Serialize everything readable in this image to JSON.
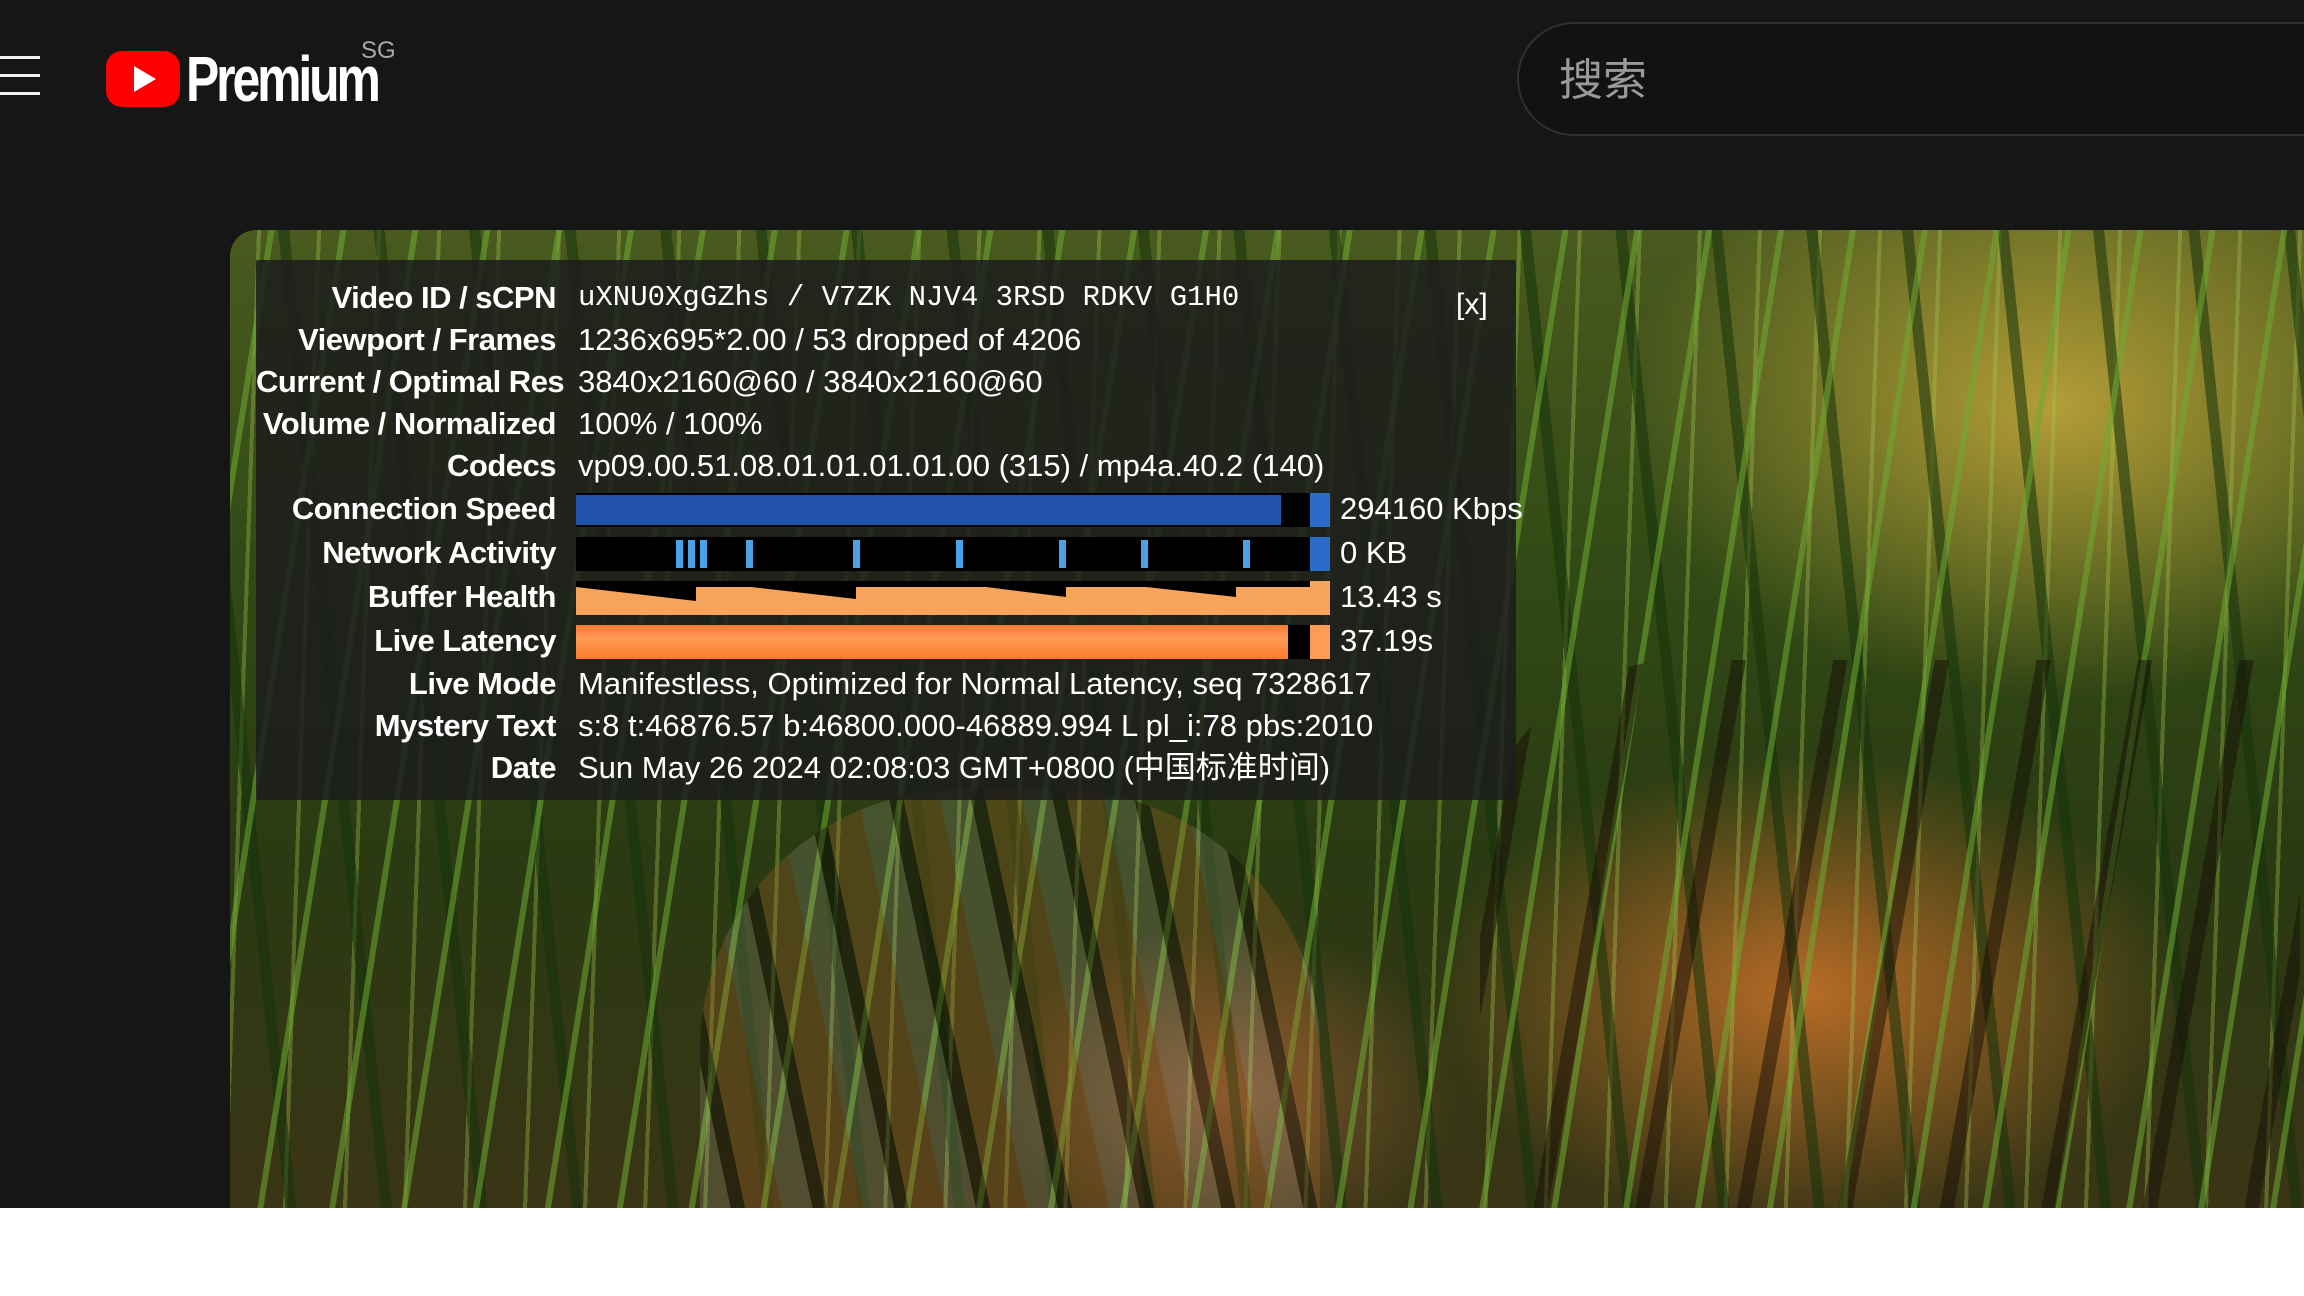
{
  "header": {
    "brand_text": "Premium",
    "region": "SG",
    "search_placeholder": "搜索"
  },
  "stats": {
    "close_label": "[x]",
    "rows": [
      {
        "label": "Video ID / sCPN",
        "value": "uXNU0XgGZhs / V7ZK NJV4 3RSD RDKV G1H0"
      },
      {
        "label": "Viewport / Frames",
        "value": "1236x695*2.00 / 53 dropped of 4206"
      },
      {
        "label": "Current / Optimal Res",
        "value": "3840x2160@60 / 3840x2160@60"
      },
      {
        "label": "Volume / Normalized",
        "value": "100% / 100%"
      },
      {
        "label": "Codecs",
        "value": "vp09.00.51.08.01.01.01.01.00 (315) / mp4a.40.2 (140)"
      },
      {
        "label": "Connection Speed",
        "value": "294160 Kbps",
        "fill_fraction": 0.96
      },
      {
        "label": "Network Activity",
        "value": "0 KB"
      },
      {
        "label": "Buffer Health",
        "value": "13.43 s"
      },
      {
        "label": "Live Latency",
        "value": "37.19s",
        "fill_fraction": 0.97
      },
      {
        "label": "Live Mode",
        "value": "Manifestless, Optimized for Normal Latency, seq 7328617"
      },
      {
        "label": "Mystery Text",
        "value": "s:8 t:46876.57 b:46800.000-46889.994 L pl_i:78 pbs:2010"
      },
      {
        "label": "Date",
        "value": "Sun May 26 2024 02:08:03 GMT+0800 (中国标准时间)"
      }
    ]
  },
  "colors": {
    "brand_red": "#ff0000",
    "speed_bar": "#1f52a8",
    "network_spike": "#4aa3e8",
    "buffer_bar": "#f6a35c",
    "latency_bar": "#ff7a30"
  }
}
